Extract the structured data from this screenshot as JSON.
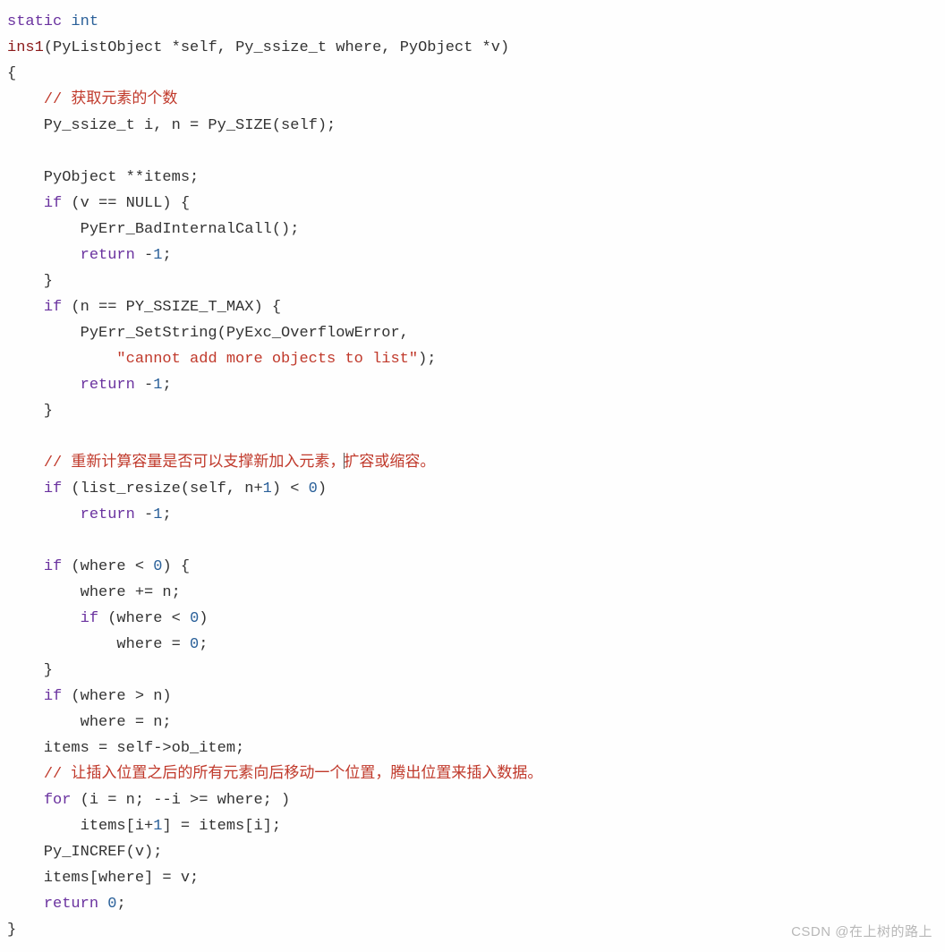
{
  "code": {
    "l01_static": "static",
    "l01_int": "int",
    "l02_func": "ins1",
    "l02_paren_open": "(",
    "l02_arg1_type": "PyListObject *",
    "l02_arg1_name": "self",
    "l02_comma1": ", ",
    "l02_arg2_type": "Py_ssize_t ",
    "l02_arg2_name": "where",
    "l02_comma2": ", ",
    "l02_arg3_type": "PyObject *",
    "l02_arg3_name": "v",
    "l02_paren_close": ")",
    "l03_brace": "{",
    "l04_cmt": "// 获取元素的个数",
    "l05": "    Py_ssize_t i, n = Py_SIZE(self);",
    "l07": "    PyObject **items;",
    "l08_if": "if",
    "l08_cond": " (v == NULL) {",
    "l09": "        PyErr_BadInternalCall();",
    "l10_ret": "return",
    "l10_val": " -",
    "l10_num": "1",
    "l10_semi": ";",
    "l11_close": "    }",
    "l12_if": "if",
    "l12_cond": " (n == PY_SSIZE_T_MAX) {",
    "l13": "        PyErr_SetString(PyExc_OverflowError,",
    "l14_str": "\"cannot add more objects to list\"",
    "l14_close": ");",
    "l15_ret": "return",
    "l15_val": " -",
    "l15_num": "1",
    "l15_semi": ";",
    "l16_close": "    }",
    "l18_cmt_a": "// 重新计算容量是否可以支撑新加入元素，",
    "l18_cmt_b": "扩容或缩容。",
    "l19_if": "if",
    "l19_cond_a": " (list_resize(self, n+",
    "l19_num": "1",
    "l19_cond_b": ") < ",
    "l19_zero": "0",
    "l19_close": ")",
    "l20_ret": "return",
    "l20_val": " -",
    "l20_num": "1",
    "l20_semi": ";",
    "l22_if": "if",
    "l22_cond": " (where < ",
    "l22_zero": "0",
    "l22_close": ") {",
    "l23": "        where += n;",
    "l24_if": "if",
    "l24_cond": " (where < ",
    "l24_zero": "0",
    "l24_close": ")",
    "l25": "            where = ",
    "l25_zero": "0",
    "l25_semi": ";",
    "l26_close": "    }",
    "l27_if": "if",
    "l27_cond": " (where > n)",
    "l28": "        where = n;",
    "l29": "    items = self->ob_item;",
    "l30_cmt": "// 让插入位置之后的所有元素向后移动一个位置，腾出位置来插入数据。",
    "l31_for": "for",
    "l31_body": " (i = n; --i >= where; )",
    "l32": "        items[i+",
    "l32_num": "1",
    "l32_rest": "] = items[i];",
    "l33": "    Py_INCREF(v);",
    "l34": "    items[where] = v;",
    "l35_ret": "return",
    "l35_sp": " ",
    "l35_zero": "0",
    "l35_semi": ";",
    "l36_brace": "}"
  },
  "watermark": "CSDN @在上树的路上"
}
